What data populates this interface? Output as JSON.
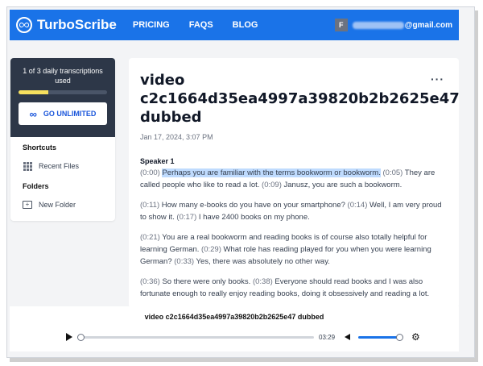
{
  "navbar": {
    "brand": "TurboScribe",
    "links": [
      "PRICING",
      "FAQS",
      "BLOG"
    ],
    "user_initial": "F",
    "email_suffix": "@gmail.com"
  },
  "sidebar": {
    "quota_text": "1 of 3 daily transcriptions used",
    "quota_used": 1,
    "quota_total": 3,
    "cta_label": "GO UNLIMITED",
    "shortcuts_heading": "Shortcuts",
    "recent_files": "Recent Files",
    "folders_heading": "Folders",
    "new_folder": "New Folder"
  },
  "file": {
    "title": "video c2c1664d35ea4997a39820b2b2625e47 dubbed",
    "date": "Jan 17, 2024, 3:07 PM",
    "speaker": "Speaker 1"
  },
  "transcript": [
    [
      {
        "ts": "(0:00)",
        "text": "Perhaps you are familiar with the terms bookworm or bookworm.",
        "highlight": true
      },
      {
        "ts": "(0:05)",
        "text": "They are called people who like to read a lot."
      },
      {
        "ts": "(0:09)",
        "text": "Janusz, you are such a bookworm."
      }
    ],
    [
      {
        "ts": "(0:11)",
        "text": "How many e-books do you have on your smartphone?"
      },
      {
        "ts": "(0:14)",
        "text": "Well, I am very proud to show it."
      },
      {
        "ts": "(0:17)",
        "text": "I have 2400 books on my phone."
      }
    ],
    [
      {
        "ts": "(0:21)",
        "text": "You are a real bookworm and reading books is of course also totally helpful for learning German."
      },
      {
        "ts": "(0:29)",
        "text": "What role has reading played for you when you were learning German?"
      },
      {
        "ts": "(0:33)",
        "text": "Yes, there was absolutely no other way."
      }
    ],
    [
      {
        "ts": "(0:36)",
        "text": "So there were only books."
      },
      {
        "ts": "(0:38)",
        "text": "Everyone should read books and I was also fortunate enough to really enjoy reading books, doing it obsessively and reading a lot."
      }
    ]
  ],
  "player": {
    "title": "video c2c1664d35ea4997a39820b2b2625e47 dubbed",
    "duration": "03:29",
    "volume_level": 1.0
  },
  "colors": {
    "brand": "#1a73e8",
    "sidebar_dark": "#2d3748",
    "quota_fill": "#f6e05e",
    "highlight": "#bfdbfe"
  }
}
